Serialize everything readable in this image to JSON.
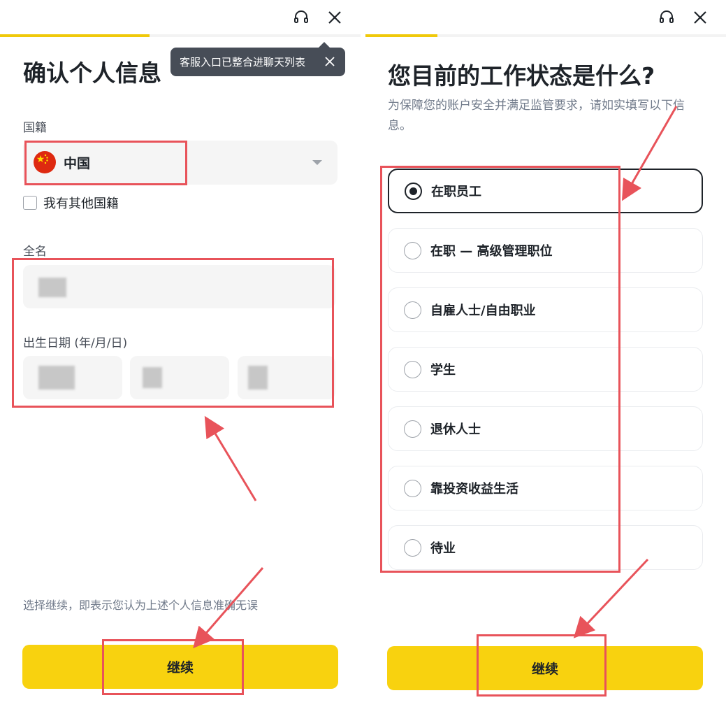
{
  "left": {
    "tooltip": {
      "text": "客服入口已整合进聊天列表",
      "close_icon": "close-icon"
    },
    "title": "确认个人信息",
    "nationality": {
      "label": "国籍",
      "selected": "中国",
      "flag_icon": "china-flag-icon",
      "other_checkbox_label": "我有其他国籍",
      "other_checked": false
    },
    "full_name": {
      "label": "全名"
    },
    "birth_date": {
      "label": "出生日期 (年/月/日)"
    },
    "note": "选择继续，即表示您认为上述个人信息准确无误",
    "continue_label": "继续"
  },
  "right": {
    "title": "您目前的工作状态是什么?",
    "subtitle": "为保障您的账户安全并满足监管要求，请如实填写以下信息。",
    "options": [
      {
        "label": "在职员工",
        "selected": true
      },
      {
        "label": "在职 — 高级管理职位",
        "selected": false
      },
      {
        "label": "自雇人士/自由职业",
        "selected": false
      },
      {
        "label": "学生",
        "selected": false
      },
      {
        "label": "退休人士",
        "selected": false
      },
      {
        "label": "靠投资收益生活",
        "selected": false
      },
      {
        "label": "待业",
        "selected": false
      }
    ],
    "continue_label": "继续"
  },
  "icons": {
    "support": "headset-icon",
    "close": "close-icon"
  },
  "colors": {
    "accent": "#f8d20f",
    "annotation": "#e8535a",
    "text": "#1e2329"
  }
}
